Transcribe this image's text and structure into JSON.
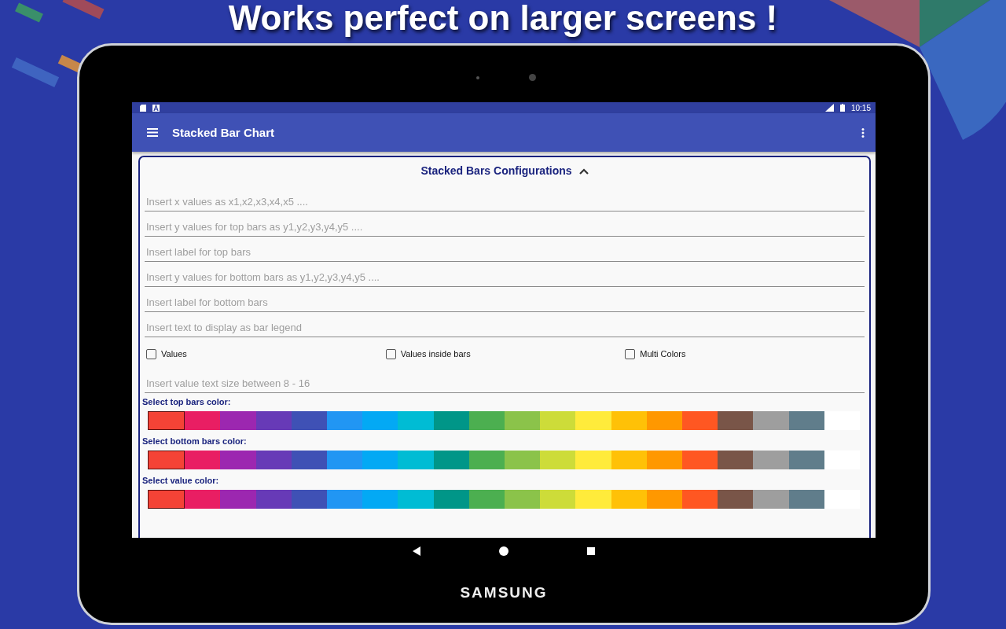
{
  "headline": "Works perfect on larger screens !",
  "device": {
    "brand": "SAMSUNG"
  },
  "status_bar": {
    "time": "10:15"
  },
  "app_bar": {
    "title": "Stacked Bar Chart"
  },
  "config_panel": {
    "title": "Stacked Bars Configurations",
    "expanded": true,
    "fields": [
      {
        "placeholder": "Insert x values as x1,x2,x3,x4,x5 ...."
      },
      {
        "placeholder": "Insert y values for top bars as y1,y2,y3,y4,y5 ...."
      },
      {
        "placeholder": "Insert label for top bars"
      },
      {
        "placeholder": "Insert y values for bottom bars as y1,y2,y3,y4,y5 ...."
      },
      {
        "placeholder": "Insert label for bottom bars"
      },
      {
        "placeholder": "Insert text to display as bar legend"
      }
    ],
    "checkboxes": [
      {
        "label": "Values",
        "checked": false
      },
      {
        "label": "Values inside bars",
        "checked": false
      },
      {
        "label": "Multi Colors",
        "checked": false
      }
    ],
    "size_field": {
      "placeholder": "Insert value text size between 8 - 16"
    },
    "palettes": [
      {
        "label": "Select top bars color:",
        "swatches": [
          {
            "color": "#f44336",
            "selected": true
          },
          {
            "color": "#e91e63",
            "selected": false
          },
          {
            "color": "#9c27b0",
            "selected": false
          },
          {
            "color": "#673ab7",
            "selected": false
          },
          {
            "color": "#3f51b5",
            "selected": false
          },
          {
            "color": "#2196f3",
            "selected": false
          },
          {
            "color": "#03a9f4",
            "selected": false
          },
          {
            "color": "#00bcd4",
            "selected": false
          },
          {
            "color": "#009688",
            "selected": false
          },
          {
            "color": "#4caf50",
            "selected": false
          },
          {
            "color": "#8bc34a",
            "selected": false
          },
          {
            "color": "#cddc39",
            "selected": false
          },
          {
            "color": "#ffeb3b",
            "selected": false
          },
          {
            "color": "#ffc107",
            "selected": false
          },
          {
            "color": "#ff9800",
            "selected": false
          },
          {
            "color": "#ff5722",
            "selected": false
          },
          {
            "color": "#795548",
            "selected": false
          },
          {
            "color": "#9e9e9e",
            "selected": false
          },
          {
            "color": "#607d8b",
            "selected": false
          },
          {
            "color": "#ffffff",
            "selected": false
          }
        ]
      },
      {
        "label": "Select bottom bars color:",
        "swatches": [
          {
            "color": "#f44336",
            "selected": true
          },
          {
            "color": "#e91e63",
            "selected": false
          },
          {
            "color": "#9c27b0",
            "selected": false
          },
          {
            "color": "#673ab7",
            "selected": false
          },
          {
            "color": "#3f51b5",
            "selected": false
          },
          {
            "color": "#2196f3",
            "selected": false
          },
          {
            "color": "#03a9f4",
            "selected": false
          },
          {
            "color": "#00bcd4",
            "selected": false
          },
          {
            "color": "#009688",
            "selected": false
          },
          {
            "color": "#4caf50",
            "selected": false
          },
          {
            "color": "#8bc34a",
            "selected": false
          },
          {
            "color": "#cddc39",
            "selected": false
          },
          {
            "color": "#ffeb3b",
            "selected": false
          },
          {
            "color": "#ffc107",
            "selected": false
          },
          {
            "color": "#ff9800",
            "selected": false
          },
          {
            "color": "#ff5722",
            "selected": false
          },
          {
            "color": "#795548",
            "selected": false
          },
          {
            "color": "#9e9e9e",
            "selected": false
          },
          {
            "color": "#607d8b",
            "selected": false
          },
          {
            "color": "#ffffff",
            "selected": false
          }
        ]
      },
      {
        "label": "Select value color:",
        "swatches": [
          {
            "color": "#f44336",
            "selected": true
          },
          {
            "color": "#e91e63",
            "selected": false
          },
          {
            "color": "#9c27b0",
            "selected": false
          },
          {
            "color": "#673ab7",
            "selected": false
          },
          {
            "color": "#3f51b5",
            "selected": false
          },
          {
            "color": "#2196f3",
            "selected": false
          },
          {
            "color": "#03a9f4",
            "selected": false
          },
          {
            "color": "#00bcd4",
            "selected": false
          },
          {
            "color": "#009688",
            "selected": false
          },
          {
            "color": "#4caf50",
            "selected": false
          },
          {
            "color": "#8bc34a",
            "selected": false
          },
          {
            "color": "#cddc39",
            "selected": false
          },
          {
            "color": "#ffeb3b",
            "selected": false
          },
          {
            "color": "#ffc107",
            "selected": false
          },
          {
            "color": "#ff9800",
            "selected": false
          },
          {
            "color": "#ff5722",
            "selected": false
          },
          {
            "color": "#795548",
            "selected": false
          },
          {
            "color": "#9e9e9e",
            "selected": false
          },
          {
            "color": "#607d8b",
            "selected": false
          },
          {
            "color": "#ffffff",
            "selected": false
          }
        ]
      }
    ]
  }
}
